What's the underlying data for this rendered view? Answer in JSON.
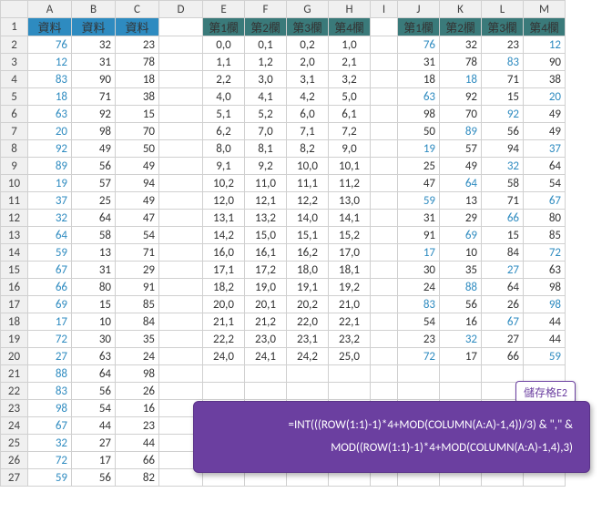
{
  "colHeaders": [
    "",
    "A",
    "B",
    "C",
    "D",
    "E",
    "F",
    "G",
    "H",
    "I",
    "J",
    "K",
    "L",
    "M"
  ],
  "rowNums": [
    1,
    2,
    3,
    4,
    5,
    6,
    7,
    8,
    9,
    10,
    11,
    12,
    13,
    14,
    15,
    16,
    17,
    18,
    19,
    20,
    21,
    22,
    23,
    24,
    25,
    26,
    27
  ],
  "r1": {
    "a": "資料",
    "b": "資料",
    "c": "資料",
    "e": "第1欄",
    "f": "第2欄",
    "g": "第3欄",
    "h": "第4欄",
    "j": "第1欄",
    "k": "第2欄",
    "l": "第3欄",
    "m": "第4欄"
  },
  "abc": [
    [
      76,
      32,
      23
    ],
    [
      12,
      31,
      78
    ],
    [
      83,
      90,
      18
    ],
    [
      18,
      71,
      38
    ],
    [
      63,
      92,
      15
    ],
    [
      20,
      98,
      70
    ],
    [
      92,
      49,
      50
    ],
    [
      89,
      56,
      49
    ],
    [
      19,
      57,
      94
    ],
    [
      37,
      25,
      49
    ],
    [
      32,
      64,
      47
    ],
    [
      64,
      58,
      54
    ],
    [
      59,
      13,
      71
    ],
    [
      67,
      31,
      29
    ],
    [
      66,
      80,
      91
    ],
    [
      69,
      15,
      85
    ],
    [
      17,
      10,
      84
    ],
    [
      72,
      30,
      35
    ],
    [
      27,
      63,
      24
    ],
    [
      88,
      64,
      98
    ],
    [
      83,
      56,
      26
    ],
    [
      98,
      54,
      16
    ],
    [
      67,
      44,
      23
    ],
    [
      32,
      27,
      44
    ],
    [
      72,
      17,
      66
    ],
    [
      59,
      56,
      82
    ]
  ],
  "efgh": [
    [
      "0,0",
      "0,1",
      "0,2",
      "1,0"
    ],
    [
      "1,1",
      "1,2",
      "2,0",
      "2,1"
    ],
    [
      "2,2",
      "3,0",
      "3,1",
      "3,2"
    ],
    [
      "4,0",
      "4,1",
      "4,2",
      "5,0"
    ],
    [
      "5,1",
      "5,2",
      "6,0",
      "6,1"
    ],
    [
      "6,2",
      "7,0",
      "7,1",
      "7,2"
    ],
    [
      "8,0",
      "8,1",
      "8,2",
      "9,0"
    ],
    [
      "9,1",
      "9,2",
      "10,0",
      "10,1"
    ],
    [
      "10,2",
      "11,0",
      "11,1",
      "11,2"
    ],
    [
      "12,0",
      "12,1",
      "12,2",
      "13,0"
    ],
    [
      "13,1",
      "13,2",
      "14,0",
      "14,1"
    ],
    [
      "14,2",
      "15,0",
      "15,1",
      "15,2"
    ],
    [
      "16,0",
      "16,1",
      "16,2",
      "17,0"
    ],
    [
      "17,1",
      "17,2",
      "18,0",
      "18,1"
    ],
    [
      "18,2",
      "19,0",
      "19,1",
      "19,2"
    ],
    [
      "20,0",
      "20,1",
      "20,2",
      "21,0"
    ],
    [
      "21,1",
      "21,2",
      "22,0",
      "22,1"
    ],
    [
      "22,2",
      "23,0",
      "23,1",
      "23,2"
    ],
    [
      "24,0",
      "24,1",
      "24,2",
      "25,0"
    ]
  ],
  "jklm": [
    [
      76,
      32,
      23,
      12
    ],
    [
      31,
      78,
      83,
      90
    ],
    [
      18,
      18,
      71,
      38
    ],
    [
      63,
      92,
      15,
      20
    ],
    [
      98,
      70,
      92,
      49
    ],
    [
      50,
      89,
      56,
      49
    ],
    [
      19,
      57,
      94,
      37
    ],
    [
      25,
      49,
      32,
      64
    ],
    [
      47,
      64,
      58,
      54
    ],
    [
      59,
      13,
      71,
      67
    ],
    [
      31,
      29,
      66,
      80
    ],
    [
      91,
      69,
      15,
      85
    ],
    [
      17,
      10,
      84,
      72
    ],
    [
      30,
      35,
      27,
      63
    ],
    [
      24,
      88,
      64,
      98
    ],
    [
      83,
      56,
      26,
      98
    ],
    [
      54,
      16,
      67,
      44
    ],
    [
      23,
      32,
      27,
      44
    ],
    [
      72,
      17,
      66,
      59
    ]
  ],
  "jklmBlue": [
    [
      1,
      0,
      0,
      1
    ],
    [
      0,
      0,
      1,
      0
    ],
    [
      0,
      1,
      0,
      0
    ],
    [
      1,
      0,
      0,
      1
    ],
    [
      0,
      0,
      1,
      0
    ],
    [
      0,
      1,
      0,
      0
    ],
    [
      1,
      0,
      0,
      1
    ],
    [
      0,
      0,
      1,
      0
    ],
    [
      0,
      1,
      0,
      0
    ],
    [
      1,
      0,
      0,
      1
    ],
    [
      0,
      0,
      1,
      0
    ],
    [
      0,
      1,
      0,
      0
    ],
    [
      1,
      0,
      0,
      1
    ],
    [
      0,
      0,
      1,
      0
    ],
    [
      0,
      1,
      0,
      0
    ],
    [
      1,
      0,
      0,
      1
    ],
    [
      0,
      0,
      1,
      0
    ],
    [
      0,
      1,
      0,
      0
    ],
    [
      1,
      0,
      0,
      1
    ]
  ],
  "tooltip": {
    "label": "儲存格E2",
    "line1": "=INT(((ROW(1:1)-1)*4+MOD(COLUMN(A:A)-1,4))/3) & \",\" &",
    "line2": "MOD((ROW(1:1)-1)*4+MOD(COLUMN(A:A)-1,4),3)"
  }
}
